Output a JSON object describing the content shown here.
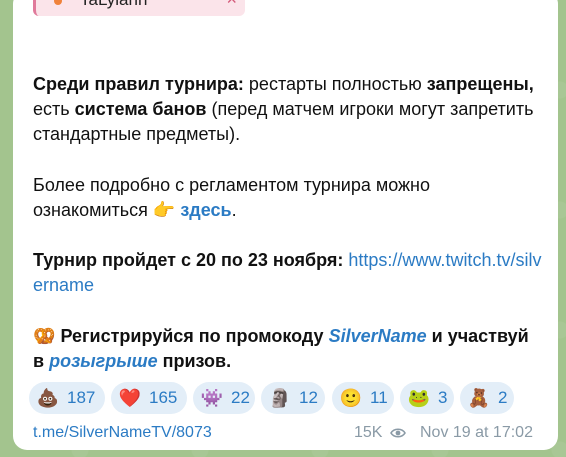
{
  "reply_chip": {
    "name": "TaLyiann",
    "close": "×"
  },
  "para1": {
    "b1": "Среди правил турнира:",
    "t1": " рестарты полностью ",
    "b2": "запрещены,",
    "t2": " есть ",
    "b3": "система банов",
    "t3": " (перед матчем игроки могут запретить стандартные предметы)."
  },
  "para2": {
    "t1": "Более подробно с регламентом турнира можно ознакомиться ",
    "emoji": "👉",
    "link": "здесь",
    "t2": "."
  },
  "para3": {
    "b1": "Турнир пройдет с 20 по 23 ноября:",
    "link": "https://www.twitch.tv/silvername"
  },
  "para4": {
    "emoji": "🥨",
    "b1": "Регистрируйся по промокоду ",
    "promo": "SilverName",
    "b2": " и участвуй в ",
    "giveaway": "розыгрыше",
    "b3": " призов."
  },
  "reactions": [
    {
      "icon": "poop-icon",
      "glyph": "💩",
      "count": "187"
    },
    {
      "icon": "heart-icon",
      "glyph": "❤️",
      "count": "165"
    },
    {
      "icon": "meat-boy-icon",
      "glyph": "👾",
      "count": "22"
    },
    {
      "icon": "moai-icon",
      "glyph": "🗿",
      "count": "12"
    },
    {
      "icon": "face-icon",
      "glyph": "🙂",
      "count": "11"
    },
    {
      "icon": "pepe-icon",
      "glyph": "🐸",
      "count": "3"
    },
    {
      "icon": "bear-icon",
      "glyph": "🧸",
      "count": "2"
    }
  ],
  "footer": {
    "link": "t.me/SilverNameTV/8073",
    "views": "15K",
    "time": "Nov 19 at 17:02"
  }
}
